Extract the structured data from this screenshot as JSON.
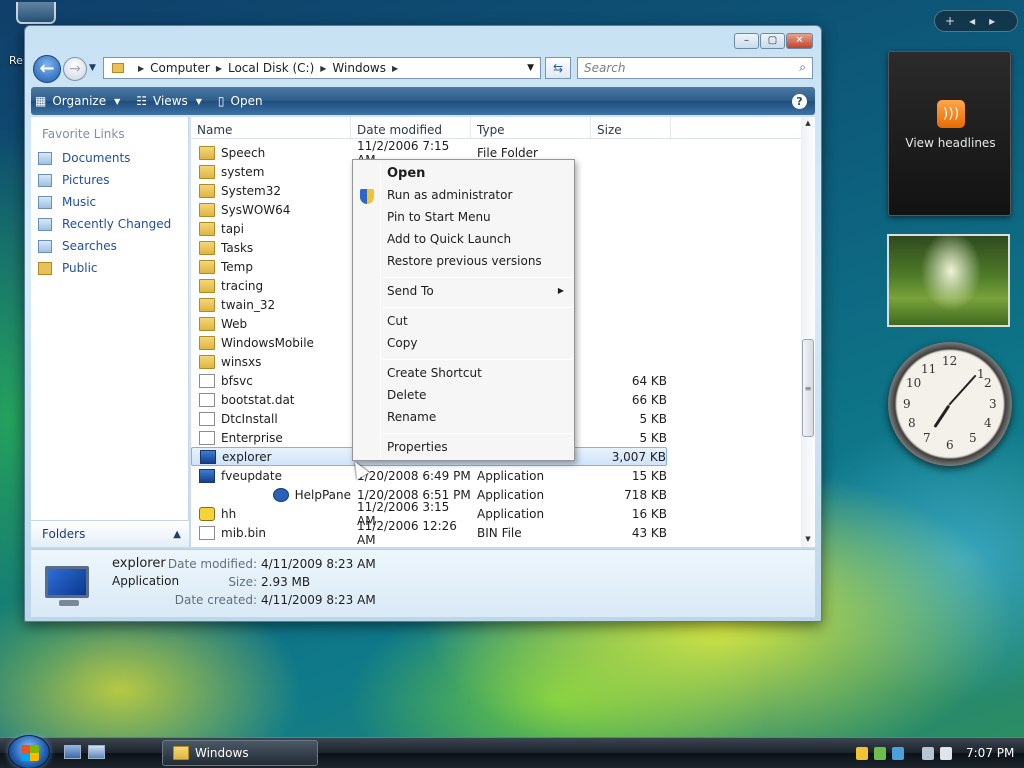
{
  "desktop": {
    "recycle_label": "Re"
  },
  "window": {
    "breadcrumb": [
      "Computer",
      "Local Disk (C:)",
      "Windows"
    ],
    "search_placeholder": "Search",
    "toolbar": {
      "organize": "Organize",
      "views": "Views",
      "open": "Open"
    },
    "nav": {
      "header": "Favorite Links",
      "links": [
        "Documents",
        "Pictures",
        "Music",
        "Recently Changed",
        "Searches",
        "Public"
      ],
      "folders": "Folders"
    },
    "columns": [
      "Name",
      "Date modified",
      "Type",
      "Size"
    ],
    "rows": [
      {
        "name": "Speech",
        "date": "11/2/2006 7:15 AM",
        "type": "File Folder",
        "size": ""
      },
      {
        "name": "system",
        "date": "",
        "type": "",
        "size": ""
      },
      {
        "name": "System32",
        "date": "",
        "type": "",
        "size": ""
      },
      {
        "name": "SysWOW64",
        "date": "",
        "type": "",
        "size": ""
      },
      {
        "name": "tapi",
        "date": "",
        "type": "",
        "size": ""
      },
      {
        "name": "Tasks",
        "date": "",
        "type": "",
        "size": ""
      },
      {
        "name": "Temp",
        "date": "",
        "type": "",
        "size": ""
      },
      {
        "name": "tracing",
        "date": "",
        "type": "",
        "size": ""
      },
      {
        "name": "twain_32",
        "date": "",
        "type": "",
        "size": ""
      },
      {
        "name": "Web",
        "date": "",
        "type": "",
        "size": ""
      },
      {
        "name": "WindowsMobile",
        "date": "",
        "type": "",
        "size": ""
      },
      {
        "name": "winsxs",
        "date": "",
        "type": "",
        "size": ""
      },
      {
        "name": "bfsvc",
        "date": "",
        "type": "",
        "size": "64 KB"
      },
      {
        "name": "bootstat.dat",
        "date": "",
        "type": "",
        "size": "66 KB"
      },
      {
        "name": "DtcInstall",
        "date": "",
        "type": "",
        "size": "5 KB"
      },
      {
        "name": "Enterprise",
        "date": "",
        "type": "",
        "size": "5 KB"
      },
      {
        "name": "explorer",
        "date": "",
        "type": "",
        "size": "3,007 KB"
      },
      {
        "name": "fveupdate",
        "date": "1/20/2008 6:49 PM",
        "type": "Application",
        "size": "15 KB"
      },
      {
        "name": "HelpPane",
        "date": "1/20/2008 6:51 PM",
        "type": "Application",
        "size": "718 KB"
      },
      {
        "name": "hh",
        "date": "11/2/2006 3:15 AM",
        "type": "Application",
        "size": "16 KB"
      },
      {
        "name": "mib.bin",
        "date": "11/2/2006 12:26 AM",
        "type": "BIN File",
        "size": "43 KB"
      }
    ],
    "details": {
      "name": "explorer",
      "kind": "Application",
      "modified_label": "Date modified:",
      "modified": "4/11/2009 8:23 AM",
      "size_label": "Size:",
      "size": "2.93 MB",
      "created_label": "Date created:",
      "created": "4/11/2009 8:23 AM"
    }
  },
  "context_menu": [
    "Open",
    "Run as administrator",
    "Pin to Start Menu",
    "Add to Quick Launch",
    "Restore previous versions",
    "Send To",
    "Cut",
    "Copy",
    "Create Shortcut",
    "Delete",
    "Rename",
    "Properties"
  ],
  "gadgets": {
    "rss_label": "View headlines",
    "clock": {
      "hour": 7,
      "minute": 7
    }
  },
  "taskbar": {
    "task": "Windows",
    "time": "7:07 PM"
  }
}
